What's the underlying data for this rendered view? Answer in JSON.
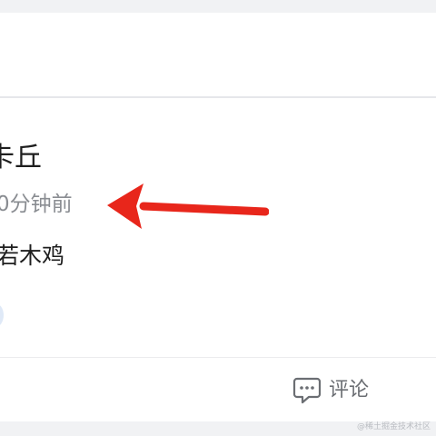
{
  "post": {
    "author_name": "卡丘",
    "time_ago": "0分钟前",
    "content": "若木鸡"
  },
  "actions": {
    "comment_label": "评论",
    "comment_icon": "comment-icon"
  },
  "annotation": {
    "arrow_color": "#e8261b"
  },
  "watermark": {
    "text": "@稀土掘金技术社区"
  },
  "colors": {
    "page_background": "#f1f2f4",
    "card_background": "#ffffff",
    "primary_text": "#1e1e1e",
    "secondary_text": "#8a8d92",
    "action_text": "#6b6e73"
  }
}
